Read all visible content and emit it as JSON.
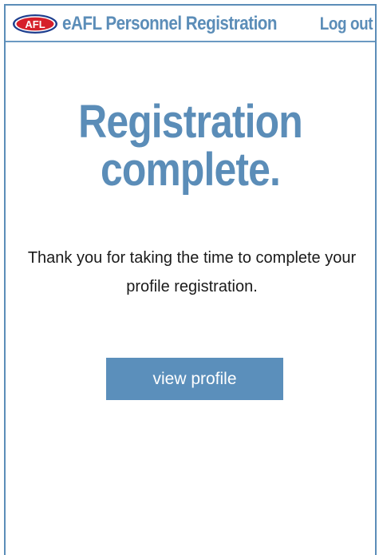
{
  "header": {
    "logo_text": "AFL",
    "title": "eAFL Personnel Registration",
    "logout_label": "Log out"
  },
  "main": {
    "headline_line1": "Registration",
    "headline_line2": "complete.",
    "message": "Thank you for taking the time to complete your profile registration.",
    "button_label": "view profile"
  },
  "colors": {
    "brand_blue": "#5b8db8",
    "button_blue": "#5b8fbb",
    "logo_red": "#d6202b",
    "logo_navy": "#1f3f8f"
  },
  "icons": [
    "afl-logo"
  ]
}
